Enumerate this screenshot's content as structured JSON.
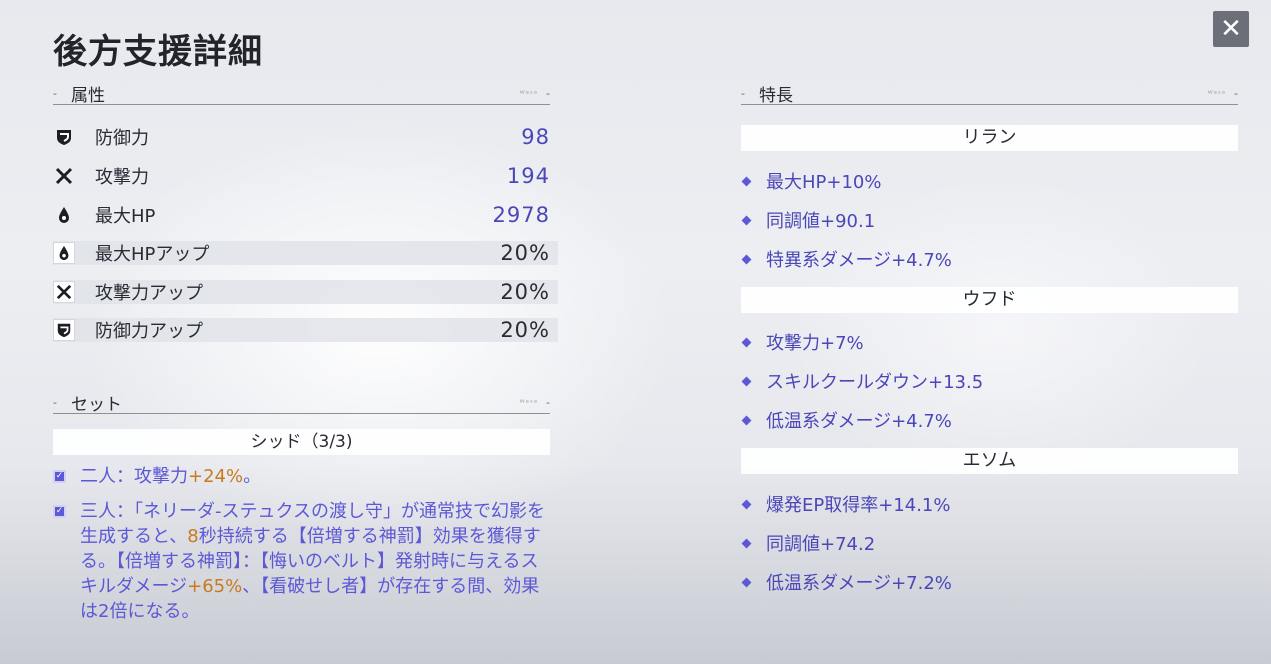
{
  "title": "後方支援詳細",
  "close_label": "✕",
  "attributes": {
    "header": "属性",
    "rows": [
      {
        "name": "防御力",
        "value": "98",
        "icon": "shield-icon"
      },
      {
        "name": "攻撃力",
        "value": "194",
        "icon": "crossed-swords-icon"
      },
      {
        "name": "最大HP",
        "value": "2978",
        "icon": "drop-icon"
      },
      {
        "name": "最大HPアップ",
        "value": "20%",
        "icon": "drop-icon"
      },
      {
        "name": "攻撃力アップ",
        "value": "20%",
        "icon": "crossed-swords-icon"
      },
      {
        "name": "防御力アップ",
        "value": "20%",
        "icon": "shield-icon"
      }
    ]
  },
  "set": {
    "header": "セット",
    "name": "シッド（3/3)",
    "bonus2_prefix": "二人：攻撃力",
    "bonus2_value": "+24%",
    "bonus2_suffix": "。",
    "bonus3_part1": "三人：「ネリーダ-ステュクスの渡し守」が通常技で幻影を生成すると、",
    "bonus3_value1": "8",
    "bonus3_part2": "秒持続する【倍増する神罰】効果を獲得する。【倍増する神罰】：【悔いのベルト】発射時に与えるスキルダメージ",
    "bonus3_value2": "+65%",
    "bonus3_part3": "、【看破せし者】が存在する間、効果は2倍になる。"
  },
  "features": {
    "header": "特長",
    "groups": [
      {
        "name": "リラン",
        "items": [
          "最大HP+10%",
          "同調値+90.1",
          "特異系ダメージ+4.7%"
        ]
      },
      {
        "name": "ウフド",
        "items": [
          "攻撃力+7%",
          "スキルクールダウン+13.5",
          "低温系ダメージ+4.7%"
        ]
      },
      {
        "name": "エソム",
        "items": [
          "爆発EP取得率+14.1%",
          "同調値+74.2",
          "低温系ダメージ+7.2%"
        ]
      }
    ]
  },
  "colors": {
    "accent": "#5c58d6",
    "highlight": "#c97a1f",
    "value_blue": "#4b47b8"
  }
}
